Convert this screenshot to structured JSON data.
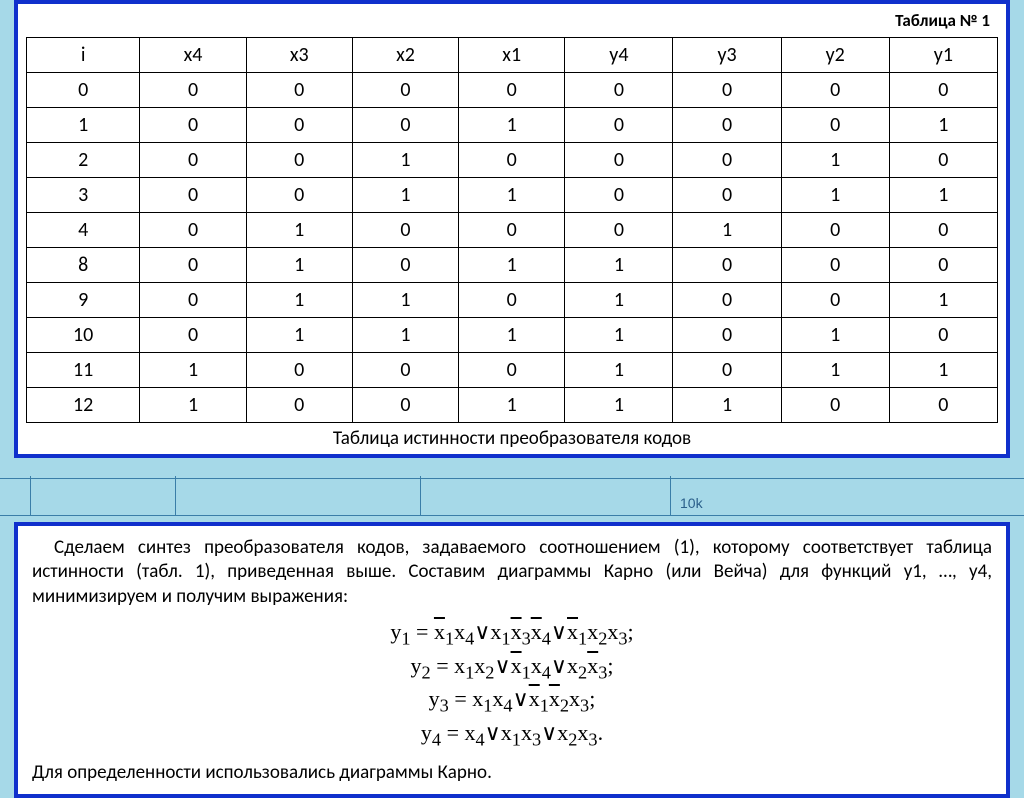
{
  "bg": {
    "label_10k": "10k"
  },
  "table": {
    "title": "Таблица № 1",
    "headers": [
      "i",
      "x4",
      "x3",
      "x2",
      "x1",
      "y4",
      "y3",
      "y2",
      "y1"
    ],
    "rows": [
      {
        "i": "0",
        "x4": "0",
        "x3": "0",
        "x2": "0",
        "x1": "0",
        "y4": "0",
        "y3": "0",
        "y2": "0",
        "y1": "0"
      },
      {
        "i": "1",
        "x4": "0",
        "x3": "0",
        "x2": "0",
        "x1": "1",
        "y4": "0",
        "y3": "0",
        "y2": "0",
        "y1": "1"
      },
      {
        "i": "2",
        "x4": "0",
        "x3": "0",
        "x2": "1",
        "x1": "0",
        "y4": "0",
        "y3": "0",
        "y2": "1",
        "y1": "0"
      },
      {
        "i": "3",
        "x4": "0",
        "x3": "0",
        "x2": "1",
        "x1": "1",
        "y4": "0",
        "y3": "0",
        "y2": "1",
        "y1": "1"
      },
      {
        "i": "4",
        "x4": "0",
        "x3": "1",
        "x2": "0",
        "x1": "0",
        "y4": "0",
        "y3": "1",
        "y2": "0",
        "y1": "0"
      },
      {
        "i": "8",
        "x4": "0",
        "x3": "1",
        "x2": "0",
        "x1": "1",
        "y4": "1",
        "y3": "0",
        "y2": "0",
        "y1": "0"
      },
      {
        "i": "9",
        "x4": "0",
        "x3": "1",
        "x2": "1",
        "x1": "0",
        "y4": "1",
        "y3": "0",
        "y2": "0",
        "y1": "1"
      },
      {
        "i": "10",
        "x4": "0",
        "x3": "1",
        "x2": "1",
        "x1": "1",
        "y4": "1",
        "y3": "0",
        "y2": "1",
        "y1": "0"
      },
      {
        "i": "11",
        "x4": "1",
        "x3": "0",
        "x2": "0",
        "x1": "0",
        "y4": "1",
        "y3": "0",
        "y2": "1",
        "y1": "1"
      },
      {
        "i": "12",
        "x4": "1",
        "x3": "0",
        "x2": "0",
        "x1": "1",
        "y4": "1",
        "y3": "1",
        "y2": "0",
        "y1": "0"
      }
    ],
    "caption": "Таблица истинности преобразователя кодов"
  },
  "text": {
    "para1": "Сделаем синтез преобразователя кодов, задаваемого соотношением (1), которому соответствует таблица истинности (табл. 1), приведенная выше. Составим диаграммы Карно (или Вейча) для функций y1, …, y4, минимизируем и получим выражения:",
    "footnote": "Для определенности использовались диаграммы Карно."
  },
  "formulas": {
    "y1": {
      "lhs": "y",
      "sub": "1",
      "eq": " = ",
      "terms": [
        {
          "ov": true,
          "base": "x",
          "sub": "1"
        },
        {
          "t": "x",
          "sub": "4"
        },
        {
          "t": "∨"
        },
        {
          "t": "x",
          "sub": "1"
        },
        {
          "ov": true,
          "base": "x",
          "sub": "3"
        },
        {
          "ov": true,
          "base": "x",
          "sub": "4"
        },
        {
          "t": "∨"
        },
        {
          "ov": true,
          "base": "x",
          "sub": "1"
        },
        {
          "t": "x",
          "sub": "2"
        },
        {
          "t": "x",
          "sub": "3"
        },
        {
          "t": ";"
        }
      ]
    },
    "y2": {
      "lhs": "y",
      "sub": "2",
      "eq": " = ",
      "terms": [
        {
          "t": "x",
          "sub": "1"
        },
        {
          "t": "x",
          "sub": "2"
        },
        {
          "t": "∨"
        },
        {
          "ov": true,
          "base": "x",
          "sub": "1"
        },
        {
          "t": "x",
          "sub": "4"
        },
        {
          "t": "∨"
        },
        {
          "t": "x",
          "sub": "2"
        },
        {
          "ov": true,
          "base": "x",
          "sub": "3"
        },
        {
          "t": ";"
        }
      ]
    },
    "y3": {
      "lhs": "y",
      "sub": "3",
      "eq": " = ",
      "terms": [
        {
          "t": "x",
          "sub": "1"
        },
        {
          "t": "x",
          "sub": "4"
        },
        {
          "t": "∨"
        },
        {
          "ov": true,
          "base": "x",
          "sub": "1"
        },
        {
          "ov": true,
          "base": "x",
          "sub": "2"
        },
        {
          "t": "x",
          "sub": "3"
        },
        {
          "t": ";"
        }
      ]
    },
    "y4": {
      "lhs": "y",
      "sub": "4",
      "eq": " = ",
      "terms": [
        {
          "t": "x",
          "sub": "4"
        },
        {
          "t": "∨"
        },
        {
          "t": "x",
          "sub": "1"
        },
        {
          "t": "x",
          "sub": "3"
        },
        {
          "t": "∨"
        },
        {
          "t": "x",
          "sub": "2"
        },
        {
          "t": "x",
          "sub": "3"
        },
        {
          "t": "."
        }
      ]
    }
  }
}
